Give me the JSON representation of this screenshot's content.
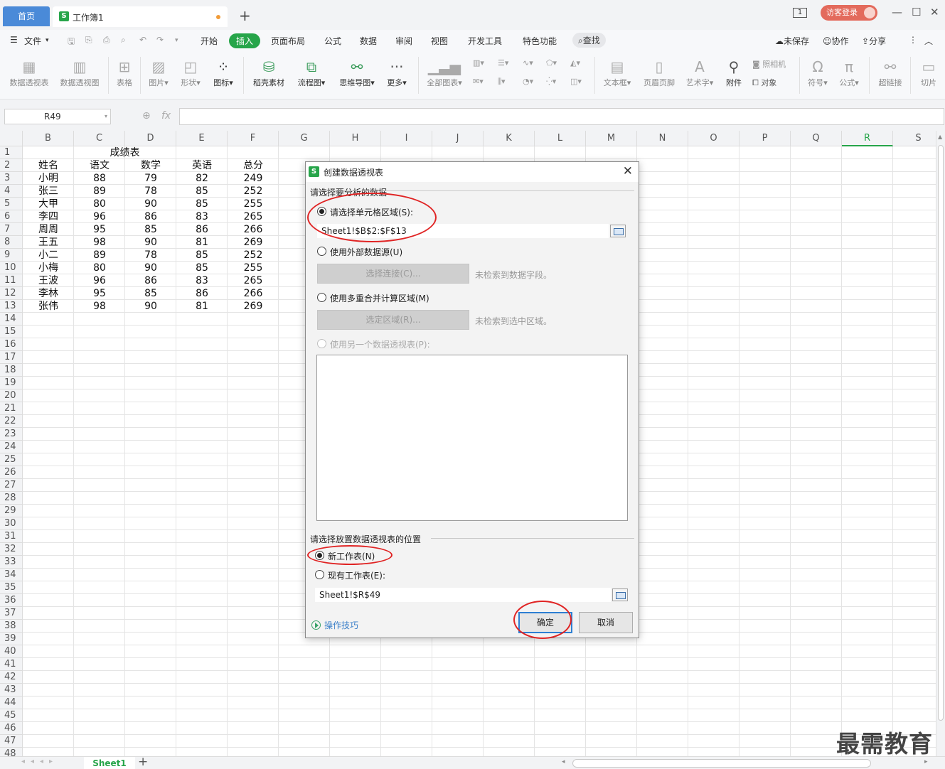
{
  "titlebar": {
    "home_tab": "首页",
    "doc_tab": "工作簿1",
    "doc_icon": "S",
    "add_tab": "+",
    "page_indicator": "1",
    "login_label": "访客登录"
  },
  "menubar": {
    "file": "文件",
    "items": [
      "开始",
      "插入",
      "页面布局",
      "公式",
      "数据",
      "审阅",
      "视图",
      "开发工具",
      "特色功能"
    ],
    "active": "插入",
    "search": "查找",
    "unsaved": "未保存",
    "collaborate": "协作",
    "share": "分享"
  },
  "ribbon": {
    "pivot_table": "数据透视表",
    "pivot_chart": "数据透视图",
    "table": "表格",
    "picture": "图片",
    "shape": "形状",
    "icon": "图标",
    "material": "稻壳素材",
    "flowchart": "流程图",
    "mindmap": "思维导图",
    "more": "更多",
    "all_charts": "全部图表",
    "textbox": "文本框",
    "header_footer": "页眉页脚",
    "wordart": "艺术字",
    "attachment": "附件",
    "camera": "照相机",
    "object": "对象",
    "symbol": "符号",
    "formula": "公式",
    "hyperlink": "超链接",
    "slicer": "切片"
  },
  "formulabar": {
    "namebox": "R49",
    "fx": "fx"
  },
  "grid": {
    "columns": [
      "B",
      "C",
      "D",
      "E",
      "F",
      "G",
      "H",
      "I",
      "J",
      "K",
      "L",
      "M",
      "N",
      "O",
      "P",
      "Q",
      "R",
      "S"
    ],
    "selected_column": "R",
    "title": "成绩表",
    "headers": [
      "姓名",
      "语文",
      "数学",
      "英语",
      "总分"
    ],
    "rows": [
      [
        "小明",
        "88",
        "79",
        "82",
        "249"
      ],
      [
        "张三",
        "89",
        "78",
        "85",
        "252"
      ],
      [
        "大甲",
        "80",
        "90",
        "85",
        "255"
      ],
      [
        "李四",
        "96",
        "86",
        "83",
        "265"
      ],
      [
        "周周",
        "95",
        "85",
        "86",
        "266"
      ],
      [
        "王五",
        "98",
        "90",
        "81",
        "269"
      ],
      [
        "小二",
        "89",
        "78",
        "85",
        "252"
      ],
      [
        "小梅",
        "80",
        "90",
        "85",
        "255"
      ],
      [
        "王波",
        "96",
        "86",
        "83",
        "265"
      ],
      [
        "李林",
        "95",
        "85",
        "86",
        "266"
      ],
      [
        "张伟",
        "98",
        "90",
        "81",
        "269"
      ]
    ]
  },
  "sheetbar": {
    "sheet_name": "Sheet1",
    "add": "+"
  },
  "dialog": {
    "title": "创建数据透视表",
    "icon": "S",
    "section_source": "请选择要分析的数据",
    "opt_range": "请选择单元格区域(S):",
    "range_value": "Sheet1!$B$2:$F$13",
    "opt_external": "使用外部数据源(U)",
    "btn_connect": "选择连接(C)...",
    "hint_connect": "未检索到数据字段。",
    "opt_consolidate": "使用多重合并计算区域(M)",
    "btn_select_range": "选定区域(R)...",
    "hint_select": "未检索到选中区域。",
    "opt_other_pivot": "使用另一个数据透视表(P):",
    "section_location": "请选择放置数据透视表的位置",
    "opt_new_sheet": "新工作表(N)",
    "opt_existing_sheet": "现有工作表(E):",
    "location_value": "Sheet1!$R$49",
    "tips": "操作技巧",
    "ok": "确定",
    "cancel": "取消"
  },
  "watermark": "最需教育",
  "colors": {
    "accent_green": "#27a54a",
    "home_tab_blue": "#4a8ad8",
    "annotation_red": "#e02424",
    "primary_button_border": "#2d7fd3"
  }
}
